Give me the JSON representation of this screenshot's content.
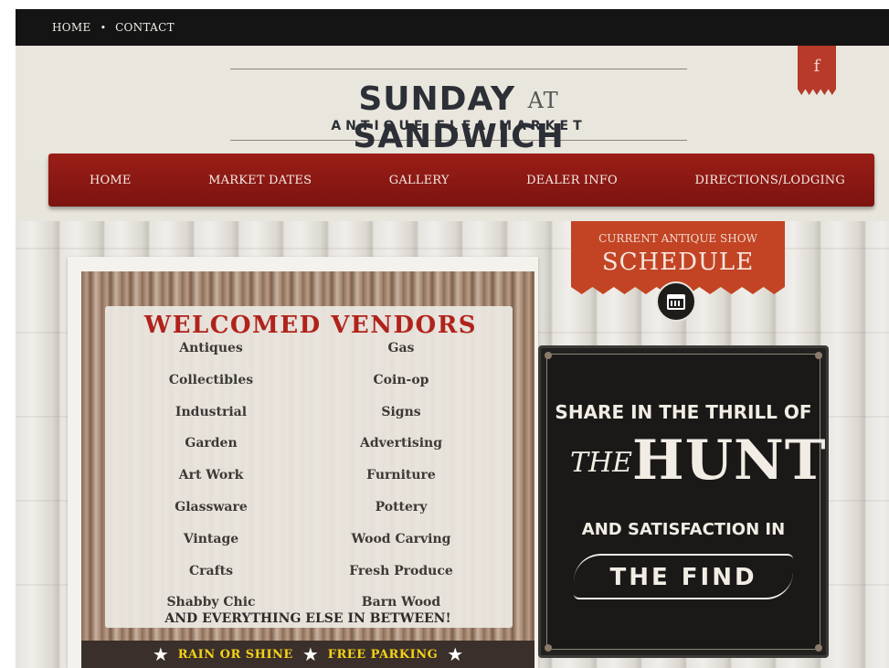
{
  "topbar": {
    "items": [
      {
        "label": "HOME"
      },
      {
        "label": "CONTACT"
      }
    ],
    "separator": "•"
  },
  "header": {
    "logo_left": "SUNDAY",
    "logo_mid": "AT",
    "logo_right": "SANDWICH",
    "logo_sub": "ANTIQUE FLEA MARKET",
    "facebook_glyph": "f"
  },
  "nav": {
    "items": [
      {
        "label": "HOME"
      },
      {
        "label": "MARKET DATES"
      },
      {
        "label": "GALLERY"
      },
      {
        "label": "DEALER INFO"
      },
      {
        "label": "DIRECTIONS/LODGING"
      }
    ]
  },
  "schedule": {
    "top": "CURRENT ANTIQUE SHOW",
    "main": "SCHEDULE",
    "icon": "calendar-icon"
  },
  "vendors": {
    "title": "WELCOMED VENDORS",
    "left": [
      "Antiques",
      "Collectibles",
      "Industrial",
      "Garden",
      "Art Work",
      "Glassware",
      "Vintage",
      "Crafts",
      "Shabby Chic"
    ],
    "right": [
      "Gas",
      "Coin-op",
      "Signs",
      "Advertising",
      "Furniture",
      "Pottery",
      "Wood Carving",
      "Fresh Produce",
      "Barn Wood"
    ],
    "everything": "AND EVERYTHING ELSE IN BETWEEN!",
    "footer_left": "RAIN OR SHINE",
    "footer_right": "FREE PARKING",
    "star": "★"
  },
  "hunt": {
    "line1": "SHARE IN THE THRILL OF",
    "the": "THE",
    "big": "HUNT",
    "line3": "AND SATISFACTION IN",
    "find": "THE FIND"
  },
  "colors": {
    "nav_red": "#8c1913",
    "schedule_orange": "#c24424",
    "vendor_title_red": "#b0231c",
    "footer_yellow": "#f4d218",
    "sign_black": "#1a1918"
  }
}
